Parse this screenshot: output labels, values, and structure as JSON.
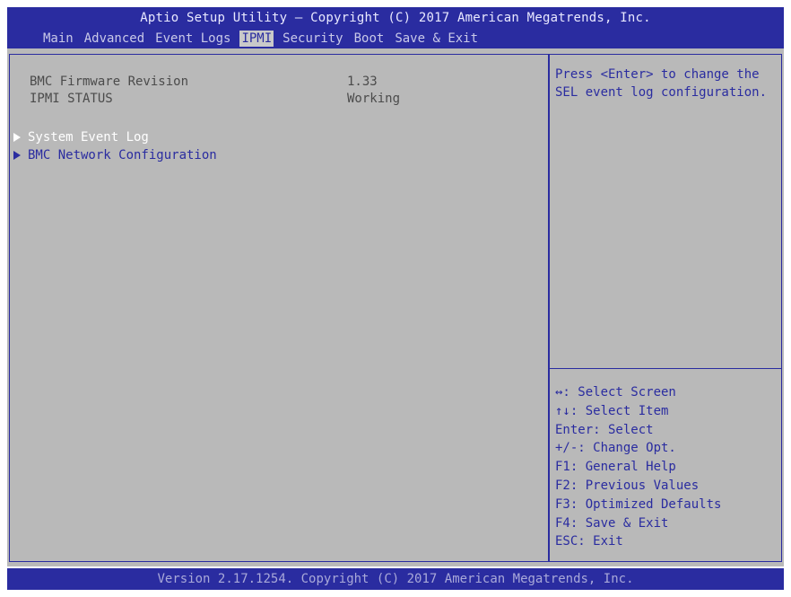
{
  "header": {
    "title": "Aptio Setup Utility – Copyright (C) 2017 American Megatrends, Inc.",
    "tabs": [
      {
        "label": "Main"
      },
      {
        "label": "Advanced"
      },
      {
        "label": "Event Logs"
      },
      {
        "label": "IPMI"
      },
      {
        "label": "Security"
      },
      {
        "label": "Boot"
      },
      {
        "label": "Save & Exit"
      }
    ],
    "active_tab": "IPMI"
  },
  "main": {
    "info": [
      {
        "label": "BMC Firmware Revision",
        "value": "1.33"
      },
      {
        "label": "IPMI STATUS",
        "value": "Working"
      }
    ],
    "submenus": [
      {
        "label": "System Event Log",
        "selected": true
      },
      {
        "label": "BMC Network Configuration",
        "selected": false
      }
    ]
  },
  "help": {
    "description": "Press <Enter> to change the SEL event log configuration."
  },
  "keys": [
    "↔: Select Screen",
    "↑↓: Select Item",
    "Enter: Select",
    "+/-: Change Opt.",
    "F1: General Help",
    "F2: Previous Values",
    "F3: Optimized Defaults",
    "F4: Save & Exit",
    "ESC: Exit"
  ],
  "footer": {
    "text": "Version 2.17.1254. Copyright (C) 2017 American Megatrends, Inc."
  },
  "colors": {
    "bar_blue": "#2a2ca0",
    "panel_gray": "#b9b9b9",
    "text_dark": "#4b4b4b",
    "selected_white": "#ffffff"
  }
}
